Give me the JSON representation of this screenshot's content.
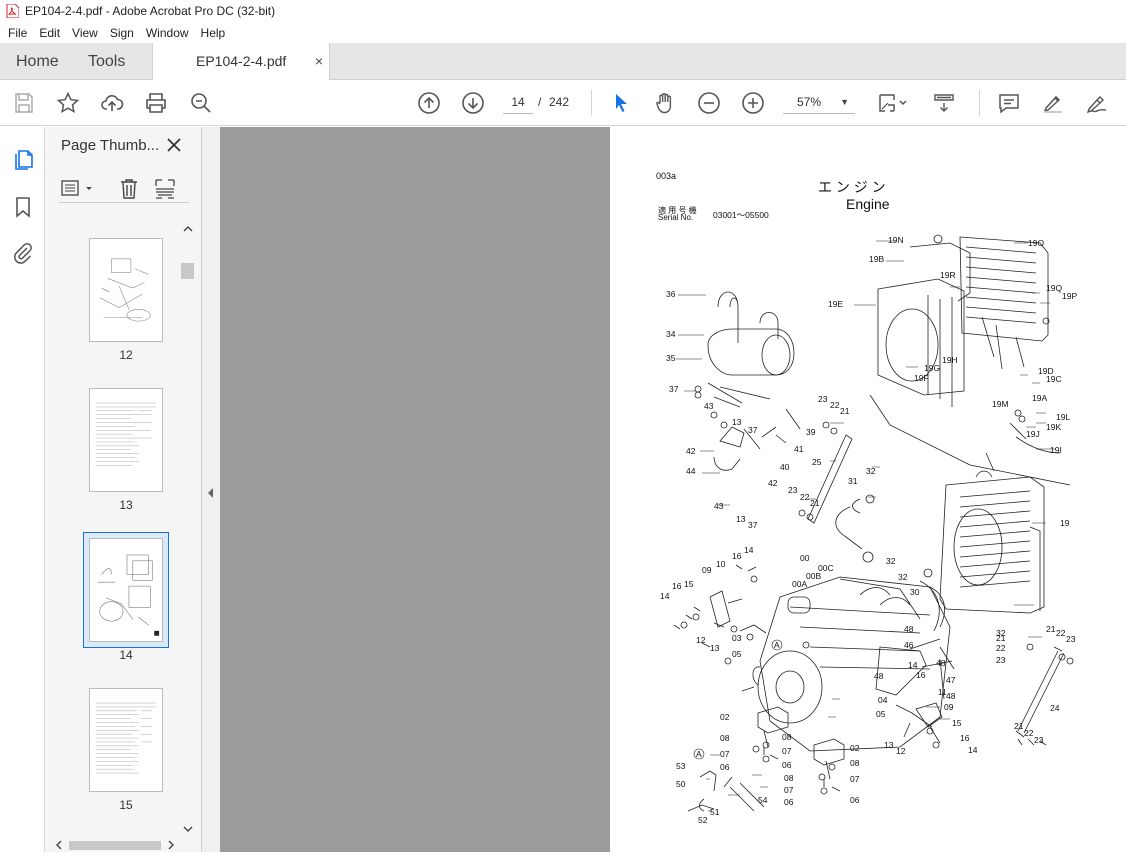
{
  "window": {
    "title": "EP104-2-4.pdf - Adobe Acrobat Pro DC (32-bit)"
  },
  "menu": [
    "File",
    "Edit",
    "View",
    "Sign",
    "Window",
    "Help"
  ],
  "tabs": {
    "home": "Home",
    "tools": "Tools",
    "document": "EP104-2-4.pdf",
    "close": "×"
  },
  "toolbar": {
    "current_page": "14",
    "page_separator": "/",
    "total_pages": "242",
    "zoom": "57%"
  },
  "panel": {
    "title": "Page Thumb...",
    "thumbnails": [
      {
        "label": "12"
      },
      {
        "label": "13"
      },
      {
        "label": "14",
        "selected": true
      },
      {
        "label": "15"
      }
    ]
  },
  "document_page": {
    "page_code": "003a",
    "title_jp": "エ ン ジ ン",
    "title_en": "Engine",
    "serial_label_jp": "適 用 号 機",
    "serial_label_en": "Serial No.",
    "serial_range": "03001～05500",
    "callouts": [
      "19N",
      "19B",
      "19R",
      "19O",
      "19E",
      "19P",
      "19Q",
      "19H",
      "19G",
      "19F",
      "19D",
      "19C",
      "19A",
      "19M",
      "19L",
      "19K",
      "19J",
      "19I",
      "36",
      "34",
      "35",
      "37",
      "43",
      "13",
      "42",
      "44",
      "39",
      "41",
      "40",
      "23",
      "22",
      "21",
      "25",
      "31",
      "32",
      "19",
      "00",
      "00C",
      "00B",
      "00A",
      "16",
      "14",
      "09",
      "10",
      "15",
      "12",
      "03",
      "05",
      "30",
      "48",
      "46",
      "47",
      "11",
      "04",
      "02",
      "08",
      "07",
      "06",
      "A",
      "53",
      "50",
      "51",
      "52",
      "54",
      "24"
    ]
  },
  "colors": {
    "accent": "#1473e6",
    "gray_area": "#9b9b9b",
    "selection": "#dbe9f8"
  }
}
